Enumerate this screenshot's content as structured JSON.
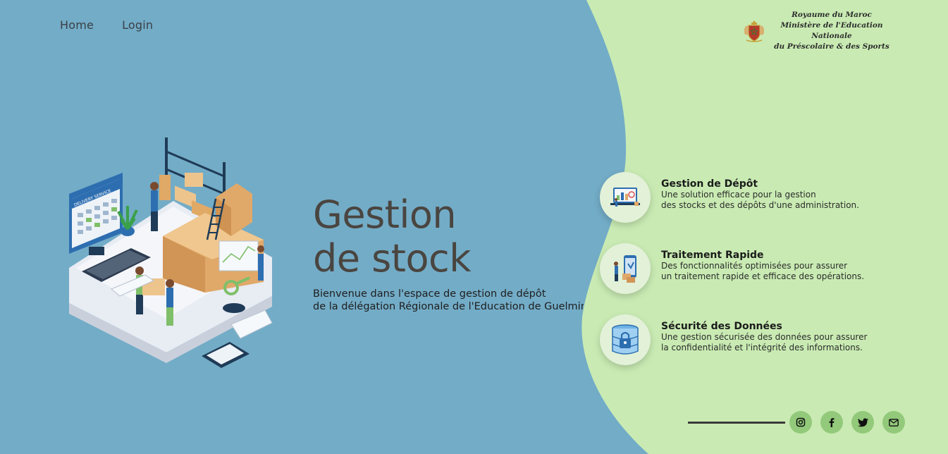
{
  "nav": {
    "home": "Home",
    "login": "Login"
  },
  "ministry": {
    "line1": "Royaume du Maroc",
    "line2": "Ministère de l'Education Nationale",
    "line3": "du Préscolaire & des Sports"
  },
  "illustration": {
    "screen_label": "DELIVERY SERVICE"
  },
  "hero": {
    "title_line1": "Gestion",
    "title_line2": "de stock",
    "subtitle_line1": "Bienvenue dans l'espace de gestion de dépôt",
    "subtitle_line2": "de la délégation Régionale de l'Education de Guelmim"
  },
  "features": [
    {
      "icon": "warehouse-dashboard-icon",
      "title": "Gestion de Dépôt",
      "line1": "Une solution efficace pour la gestion",
      "line2": "des stocks et des dépôts d'une administration."
    },
    {
      "icon": "phone-delivery-icon",
      "title": "Traitement Rapide",
      "line1": "Des fonctionnalités optimisées pour assurer",
      "line2": "un traitement rapide et efficace des opérations."
    },
    {
      "icon": "database-lock-icon",
      "title": "Sécurité des Données",
      "line1": "Une gestion sécurisée des données pour assurer",
      "line2": "la confidentialité et l'intégrité des informations."
    }
  ],
  "social": [
    "instagram-icon",
    "facebook-icon",
    "twitter-icon",
    "email-icon"
  ],
  "colors": {
    "left_bg": "#73acc7",
    "right_bg": "#c9ebb3",
    "accent": "#93c97a"
  }
}
